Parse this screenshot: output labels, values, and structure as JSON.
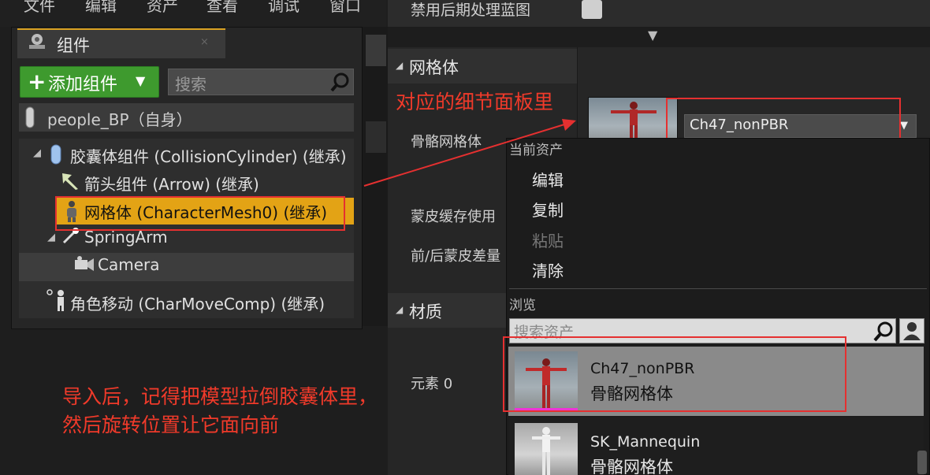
{
  "menubar": {
    "items": [
      "文件",
      "编辑",
      "资产",
      "查看",
      "调试",
      "窗口"
    ]
  },
  "components": {
    "tab_label": "组件",
    "tab_close": "×",
    "add_button": "添加组件",
    "search_placeholder": "搜索",
    "self_row": "people_BP（自身）",
    "tree": [
      "胶囊体组件 (CollisionCylinder) (继承)",
      "箭头组件 (Arrow) (继承)",
      "网格体 (CharacterMesh0) (继承)",
      "SpringArm",
      "Camera",
      "角色移动 (CharMoveComp) (继承)"
    ]
  },
  "details": {
    "postprocess_label": "禁用后期处理蓝图",
    "cat_mesh": "网格体",
    "skeletal_mesh_label": "骨骼网格体",
    "skin_cache_label": "蒙皮缓存使用",
    "morph_label": "前/后蒙皮差量",
    "cat_material": "材质",
    "element_label": "元素 0",
    "combo_value": "Ch47_nonPBR"
  },
  "dropdown": {
    "section_current": "当前资产",
    "items": [
      {
        "label": "编辑",
        "enabled": true
      },
      {
        "label": "复制",
        "enabled": true
      },
      {
        "label": "粘贴",
        "enabled": false
      },
      {
        "label": "清除",
        "enabled": true
      }
    ],
    "section_browse": "浏览",
    "search_placeholder": "搜索资产",
    "assets": [
      {
        "name": "Ch47_nonPBR",
        "type": "骨骼网格体",
        "selected": true
      },
      {
        "name": "SK_Mannequin",
        "type": "骨骼网格体",
        "selected": false
      }
    ]
  },
  "annotations": {
    "note_top": "对应的细节面板里",
    "note_bottom_line1": "导入后，记得把模型拉倒胶囊体里，",
    "note_bottom_line2": "然后旋转位置让它面向前"
  },
  "colors": {
    "annotation_red": "#e53030",
    "selection_highlight": "#e3a315",
    "add_button_green": "#3e9a2e",
    "asset_underline": "#f033d6"
  }
}
